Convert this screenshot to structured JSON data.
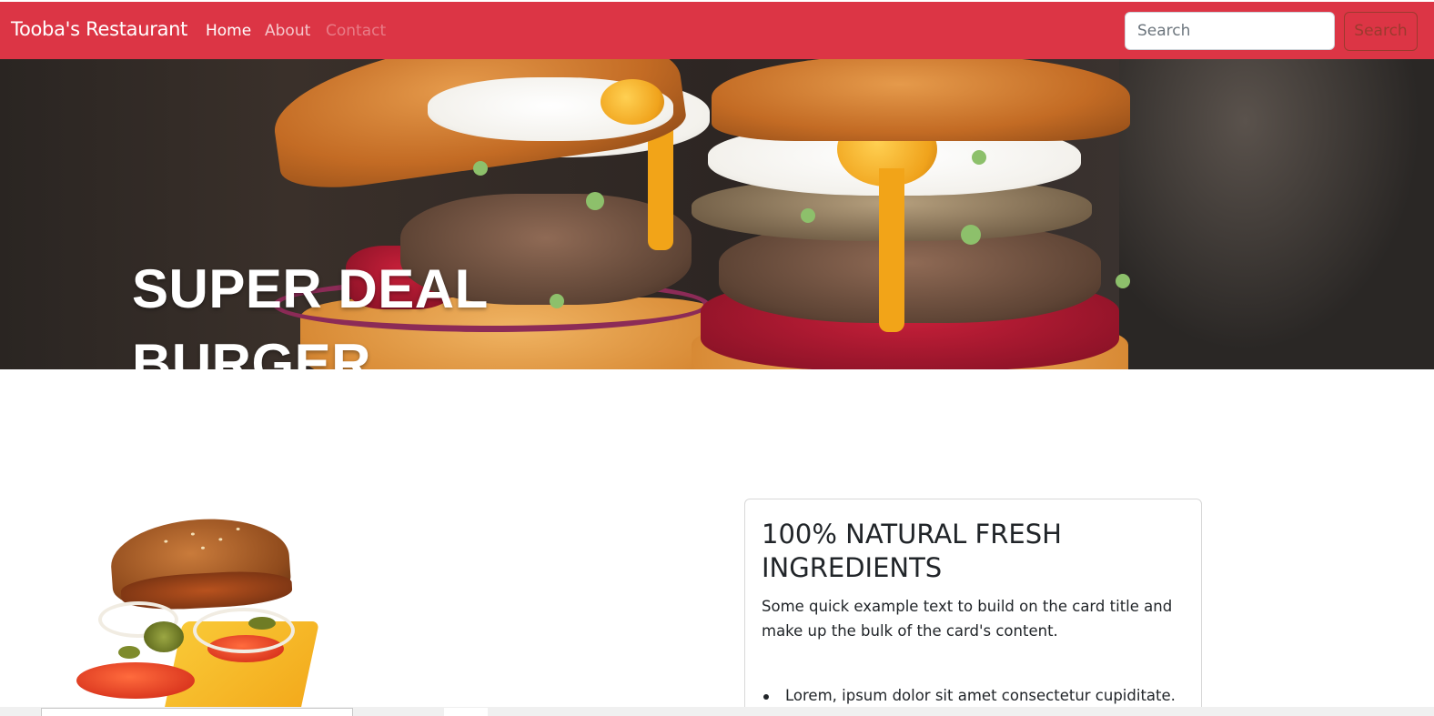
{
  "navbar": {
    "brand": "Tooba's Restaurant",
    "links": [
      "Home",
      "About",
      "Contact"
    ],
    "search_placeholder": "Search",
    "search_button": "Search",
    "color": "#dc3545"
  },
  "hero": {
    "title_line1": "SUPER DEAL",
    "title_line2": "BURGER",
    "image": "double-egg-burger-image"
  },
  "feature": {
    "image": "exploded-burger-image",
    "card": {
      "title": "100% NATURAL FRESH INGREDIENTS",
      "text": "Some quick example text to build on the card title and make up the bulk of the card's content.",
      "list": [
        "Lorem, ipsum dolor sit amet consectetur cupiditate."
      ]
    }
  }
}
